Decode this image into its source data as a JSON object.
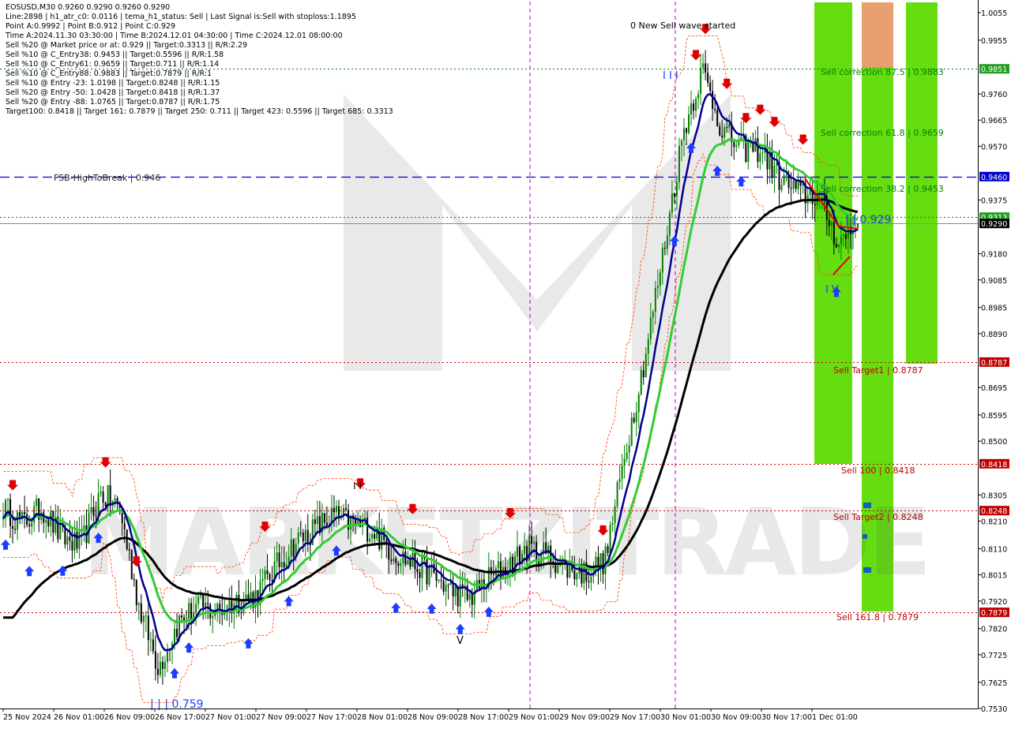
{
  "chart_data": {
    "type": "candlestick",
    "symbol": "EOSUSD",
    "timeframe": "M30",
    "title": "EOSUSD,M30  0.9260 0.9290 0.9260 0.9290",
    "info_lines": [
      "Line:2898 | h1_atr_c0: 0.0116 | tema_h1_status: Sell | Last Signal is:Sell with stoploss:1.1895",
      "Point A:0.9992 | Point B:0.912 | Point C:0.929",
      "Time A:2024.11.30 03:30:00 | Time B:2024.12.01 04:30:00 | Time C:2024.12.01 08:00:00",
      "Sell %20 @ Market price or at: 0.929 || Target:0.3313 || R/R:2.29",
      "Sell %10 @ C_Entry38: 0.9453 || Target:0.5596 || R/R:1.58",
      "Sell %10 @ C_Entry61: 0.9659 || Target:0.711 || R/R:1.14",
      "Sell %10 @ C_Entry88: 0.9883 || Target:0.7879 || R/R:1",
      "Sell %10 @ Entry -23: 1.0198 || Target:0.8248 || R/R:1.15",
      "Sell %20 @ Entry -50: 1.0428 || Target:0.8418 || R/R:1.37",
      "Sell %20 @ Entry -88: 1.0765 || Target:0.8787 || R/R:1.75",
      "Target100: 0.8418 || Target 161: 0.7879 || Target 250: 0.711 || Target 423: 0.5596 || Target 685: 0.3313"
    ],
    "y_axis": {
      "range": [
        0.753,
        1.0095
      ],
      "ticks": [
        "1.0055",
        "0.9955",
        "0.9760",
        "0.9665",
        "0.9570",
        "0.9375",
        "0.9180",
        "0.9085",
        "0.8985",
        "0.8890",
        "0.8695",
        "0.8595",
        "0.8500",
        "0.8305",
        "0.8210",
        "0.8110",
        "0.8015",
        "0.7920",
        "0.7820",
        "0.7725",
        "0.7625",
        "0.7530"
      ]
    },
    "x_axis": {
      "labels": [
        "25 Nov 2024",
        "26 Nov 01:00",
        "26 Nov 09:00",
        "26 Nov 17:00",
        "27 Nov 01:00",
        "27 Nov 09:00",
        "27 Nov 17:00",
        "28 Nov 01:00",
        "28 Nov 09:00",
        "28 Nov 17:00",
        "29 Nov 01:00",
        "29 Nov 09:00",
        "29 Nov 17:00",
        "30 Nov 01:00",
        "30 Nov 09:00",
        "30 Nov 17:00",
        "1 Dec 01:00"
      ]
    },
    "horizontal_levels": [
      {
        "label": "Sell correction 87.5 | 0.9883",
        "value": 0.9851,
        "tag": "0.9851",
        "color": "#008000",
        "style": "dotted"
      },
      {
        "label": "Sell correction 61.8 | 0.9659",
        "value": 0.9659,
        "tag": "",
        "color": "#008000",
        "style": "none"
      },
      {
        "label": "FSB-HighToBreak | 0.946",
        "value": 0.946,
        "tag": "0.9460",
        "color": "#0000cd",
        "style": "dashed"
      },
      {
        "label": "Sell correction 38.2 | 0.9453",
        "value": 0.9453,
        "tag": "",
        "color": "#008000",
        "style": "none"
      },
      {
        "label": "",
        "value": 0.9313,
        "tag": "0.9313",
        "color": "#008000",
        "style": "dotted"
      },
      {
        "label": "",
        "value": 0.929,
        "tag": "0.9290",
        "color": "#000000",
        "style": "solid"
      },
      {
        "label": "Sell Target1 | 0.8787",
        "value": 0.8787,
        "tag": "0.8787",
        "color": "#c00000",
        "style": "dotted"
      },
      {
        "label": "Sell 100 | 0.8418",
        "value": 0.8418,
        "tag": "0.8418",
        "color": "#c00000",
        "style": "dotted"
      },
      {
        "label": "Sell Target2 | 0.8248",
        "value": 0.8248,
        "tag": "0.8248",
        "color": "#c00000",
        "style": "dotted"
      },
      {
        "label": "Sell 161.8 | 0.7879",
        "value": 0.7879,
        "tag": "0.7879",
        "color": "#c00000",
        "style": "dotted"
      }
    ],
    "annotations": [
      {
        "text": "0 New Sell wave started",
        "near": "top-center"
      },
      {
        "text": "| | | 0.759",
        "near": "bottom-left"
      },
      {
        "text": "| | 0.929",
        "near": "right"
      },
      {
        "text": "I V",
        "near": "right"
      },
      {
        "text": "V",
        "near": "bottom-center"
      },
      {
        "text": "I I I",
        "near": "top-center"
      },
      {
        "text": "I I",
        "near": "left"
      }
    ],
    "moving_averages": [
      {
        "color": "#00008b",
        "description": "fast"
      },
      {
        "color": "#33cc33",
        "description": "medium"
      },
      {
        "color": "#000000",
        "description": "slow"
      }
    ],
    "watermark": "MARKETZITRADE",
    "colors": {
      "zone_green": "#66dd11",
      "zone_orange": "#e8a070",
      "bull_candle": "#008000",
      "bear_candle": "#000000",
      "sell_arrow": "#dd0000",
      "buy_arrow": "#1e3cff",
      "envelope": "#ff4000"
    },
    "price_path_anchors": [
      [
        0.826,
        0.82,
        0.826,
        0.815,
        0.812,
        0.831,
        0.826,
        0.79,
        0.768,
        0.784,
        0.79,
        0.788,
        0.792,
        0.794,
        0.804,
        0.813,
        0.818,
        0.823,
        0.82,
        0.818,
        0.81,
        0.806,
        0.802,
        0.796,
        0.793,
        0.8,
        0.805,
        0.811,
        0.809,
        0.804,
        0.802,
        0.807,
        0.845,
        0.879,
        0.919,
        0.962,
        0.985,
        0.963,
        0.956,
        0.956,
        0.945,
        0.94,
        0.939,
        0.922,
        0.929
      ]
    ]
  }
}
